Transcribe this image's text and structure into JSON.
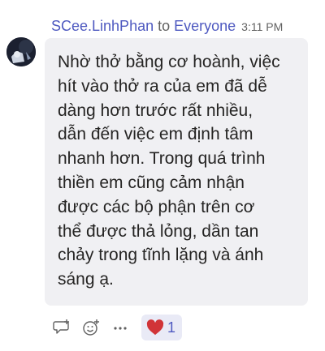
{
  "message": {
    "sender": "SCee.LinhPhan",
    "to_word": "to",
    "recipient": "Everyone",
    "time": "3:11 PM",
    "text": "Nhờ thở bằng cơ hoành, việc\nhít vào thở ra của em đã dễ\ndàng hơn trước rất nhiều,\ndẫn đến việc em định tâm\nnhanh hơn. Trong quá trình\nthiền em cũng cảm nhận\nđược các bộ phận trên cơ\nthể được thả lỏng, dần tan\nchảy trong tĩnh lặng và ánh\nsáng ạ."
  },
  "actions": {
    "reply_icon": "reply-icon",
    "emoji_icon": "add-emoji-icon",
    "more_icon": "more-options-icon"
  },
  "reaction": {
    "icon": "heart-icon",
    "count": "1",
    "color": "#d13438"
  },
  "colors": {
    "accent": "#4e59c0",
    "bubble": "#f0f0f3",
    "text": "#252423",
    "meta": "#616161"
  }
}
